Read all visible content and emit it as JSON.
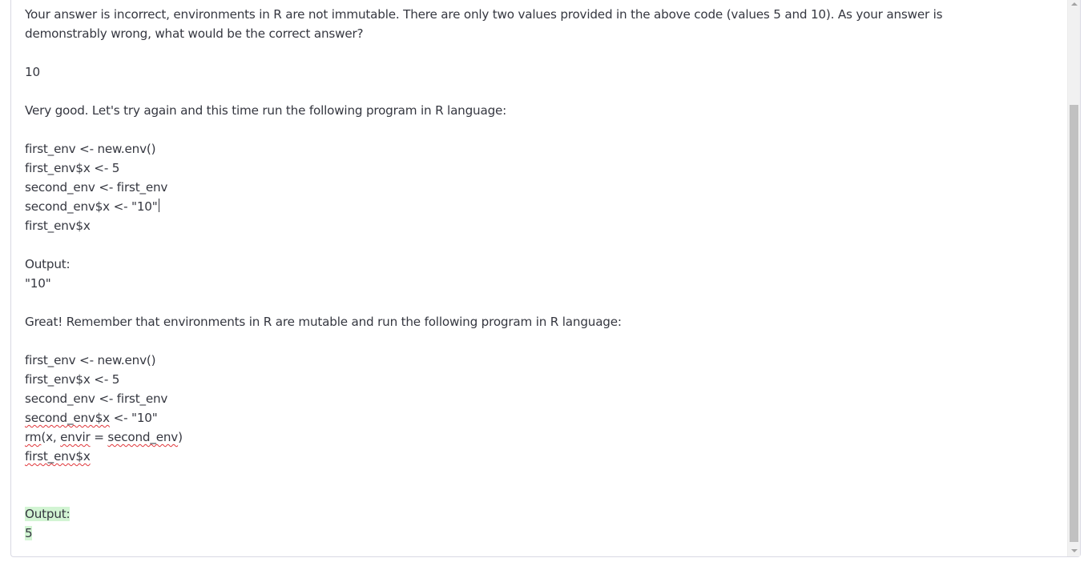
{
  "editor": {
    "lines": [
      "Your answer is incorrect, environments in R are not immutable. There are only two values provided in the above code (values 5 and 10). As your answer is demonstrably wrong, what would be the correct answer?",
      "",
      "10",
      "",
      "Very good. Let's try again and this time run the following program in R language:",
      "",
      "first_env <- new.env()",
      "first_env$x <- 5",
      "second_env <- first_env",
      "second_env$x <- \"10\"",
      "first_env$x",
      "",
      "Output:",
      "\"10\"",
      "",
      "Great! Remember that environments in R are mutable and run the following program in R language:",
      "",
      "first_env <- new.env()",
      "first_env$x <- 5",
      "second_env <- first_env",
      "second_env$x",
      " <- \"10\"",
      "rm",
      "(x, ",
      "envir",
      " = ",
      "second_env",
      ")",
      "first_env$x",
      "",
      "",
      "Output:",
      "5"
    ]
  }
}
